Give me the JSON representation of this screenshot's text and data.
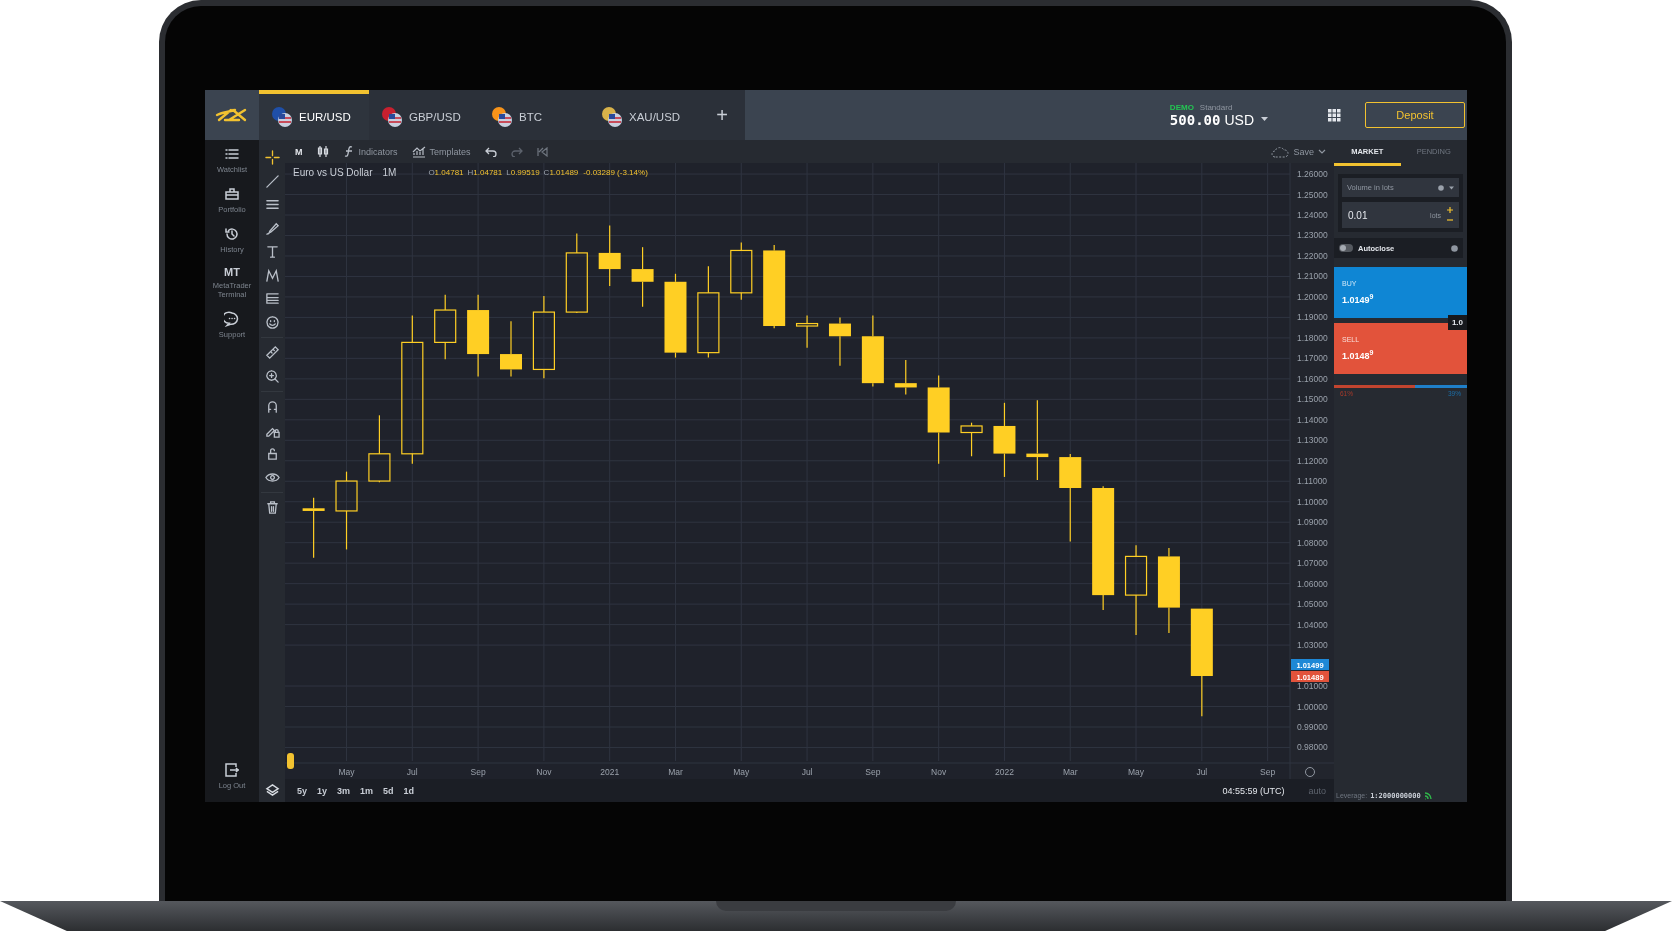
{
  "top_bar": {
    "tabs": [
      {
        "label": "EUR/USD",
        "selected": true
      },
      {
        "label": "GBP/USD",
        "selected": false
      },
      {
        "label": "BTC",
        "selected": false
      },
      {
        "label": "XAU/USD",
        "selected": false
      }
    ],
    "add_tab": "+",
    "account": {
      "mode": "DEMO",
      "type": "Standard",
      "balance": "500.00",
      "currency": "USD"
    },
    "deposit": "Deposit"
  },
  "nav": {
    "items": [
      {
        "label": "Watchlist"
      },
      {
        "label": "Portfolio"
      },
      {
        "label": "History"
      },
      {
        "icon_text": "MT",
        "label": "MetaTrader Terminal"
      },
      {
        "label": "Support"
      }
    ],
    "logout": "Log Out"
  },
  "drawing_tools": [
    {
      "selected": true
    },
    {
      "selected": false
    },
    {
      "selected": false
    },
    {
      "selected": false
    },
    {
      "selected": false
    },
    {
      "selected": false
    },
    {
      "selected": false
    },
    {
      "selected": false
    },
    {
      "selected": false
    },
    {
      "selected": false
    },
    {
      "selected": false
    },
    {
      "selected": false
    },
    {
      "selected": false
    },
    {
      "selected": false
    },
    {
      "selected": false
    }
  ],
  "chart_toolbar": {
    "timeframe": "M",
    "indicators": "Indicators",
    "templates": "Templates",
    "save": "Save"
  },
  "chart": {
    "symbol": "Euro vs US Dollar",
    "period": "1M",
    "ohlc": [
      {
        "label": "O",
        "value": "1.04781"
      },
      {
        "label": "H",
        "value": "1.04781"
      },
      {
        "label": "L",
        "value": "0.99519"
      },
      {
        "label": "C",
        "value": "1.01489"
      }
    ],
    "change": "-0.03289 (-3.14%)",
    "price_axis": [
      "1.26000",
      "1.25000",
      "1.24000",
      "1.23000",
      "1.22000",
      "1.21000",
      "1.20000",
      "1.19000",
      "1.18000",
      "1.17000",
      "1.16000",
      "1.15000",
      "1.14000",
      "1.13000",
      "1.12000",
      "1.11000",
      "1.10000",
      "1.09000",
      "1.08000",
      "1.07000",
      "1.06000",
      "1.05000",
      "1.04000",
      "1.03000",
      "1.01000",
      "1.00000",
      "0.99000",
      "0.98000"
    ],
    "time_axis": [
      "May",
      "Jul",
      "Sep",
      "Nov",
      "2021",
      "Mar",
      "May",
      "Jul",
      "Sep",
      "Nov",
      "2022",
      "Mar",
      "May",
      "Jul",
      "Sep"
    ],
    "price_tags": [
      {
        "label": "1.01499",
        "color": "#1e88d6"
      },
      {
        "label": "1.01489",
        "color": "#e2533b"
      }
    ]
  },
  "bottom_bar": {
    "ranges": [
      "5y",
      "1y",
      "3m",
      "1m",
      "5d",
      "1d"
    ],
    "time": "04:55:59 (UTC)",
    "scale": "auto"
  },
  "order_panel": {
    "tabs": [
      {
        "label": "MARKET",
        "selected": true
      },
      {
        "label": "PENDING",
        "selected": false
      }
    ],
    "volume_mode": "Volume in lots",
    "volume": "0.01",
    "unit": "lots",
    "autoclose": {
      "label": "Autoclose",
      "on": false
    },
    "buy": {
      "label": "BUY",
      "price": "1.01**49**$^{9}$"
    },
    "spread": "1.0",
    "sell": {
      "label": "SELL",
      "price": "1.01**48**$^{9}$"
    },
    "sentiment": {
      "level": 0.61,
      "sell": "61%",
      "buy": "39%"
    },
    "leverage_label": "Leverage:",
    "leverage": "1:2000000000"
  }
}
